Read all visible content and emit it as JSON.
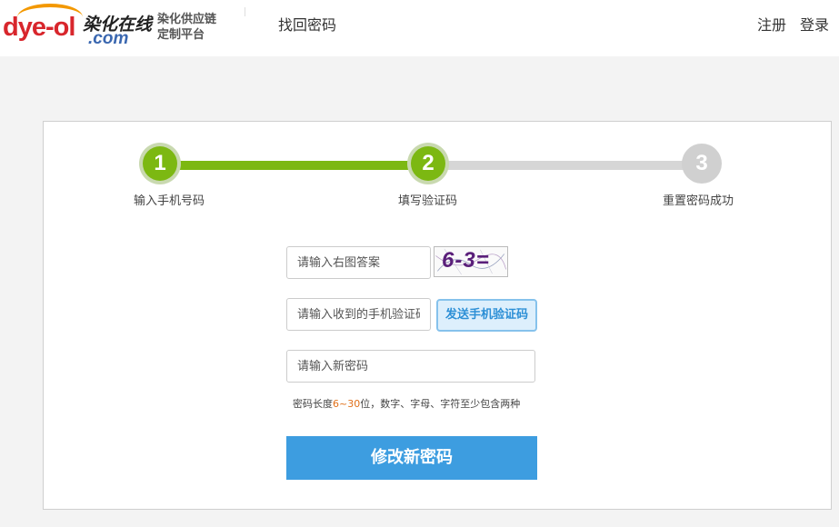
{
  "header": {
    "logo": {
      "brand_latin": "dye-ol",
      "brand_cn": "染化在线",
      "domain": ".com",
      "slogan_line1": "染化供应链",
      "slogan_line2": "定制平台"
    },
    "page_title": "找回密码",
    "nav": {
      "register": "注册",
      "login": "登录"
    }
  },
  "steps": [
    {
      "number": "1",
      "label": "输入手机号码",
      "state": "done"
    },
    {
      "number": "2",
      "label": "填写验证码",
      "state": "current"
    },
    {
      "number": "3",
      "label": "重置密码成功",
      "state": "todo"
    }
  ],
  "form": {
    "captcha_input": {
      "placeholder": "请输入右图答案",
      "value": ""
    },
    "captcha_image_text": "6-3=",
    "sms_input": {
      "placeholder": "请输入收到的手机验证码",
      "value": ""
    },
    "sms_button": "发送手机验证码",
    "password_input": {
      "placeholder": "请输入新密码",
      "value": ""
    },
    "hint_before": "密码长度",
    "hint_accent": "6~30",
    "hint_after": "位，数字、字母、字符至少包含两种",
    "submit": "修改新密码"
  },
  "colors": {
    "brand_red": "#d8262c",
    "progress_green": "#7cb812",
    "progress_gray": "#d6d6d6",
    "primary_blue": "#3d9de0",
    "hint_accent": "#e0701a"
  }
}
